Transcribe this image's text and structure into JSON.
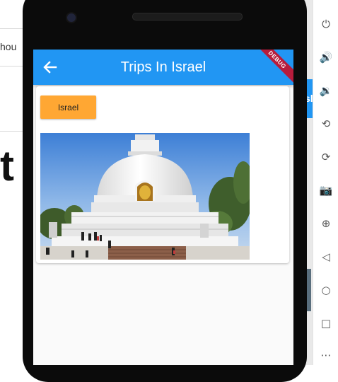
{
  "background": {
    "left_snippet": "hou",
    "left_big_letter": "t",
    "right_tab_text": "sl"
  },
  "side_toolbar": [
    {
      "name": "power-icon",
      "glyph": "⏻"
    },
    {
      "name": "volume-up-icon",
      "glyph": "🔊"
    },
    {
      "name": "volume-down-icon",
      "glyph": "🔉"
    },
    {
      "name": "rotate-left-icon",
      "glyph": "⟲"
    },
    {
      "name": "rotate-right-icon",
      "glyph": "⟳"
    },
    {
      "name": "camera-icon",
      "glyph": "📷"
    },
    {
      "name": "zoom-icon",
      "glyph": "⊕"
    },
    {
      "name": "back-icon",
      "glyph": "◁"
    },
    {
      "name": "home-icon",
      "glyph": "○"
    },
    {
      "name": "overview-icon",
      "glyph": "□"
    },
    {
      "name": "more-icon",
      "glyph": "⋯"
    }
  ],
  "app": {
    "title": "Trips In Israel",
    "debug_banner": "DEBUG",
    "card": {
      "chip_label": "Israel",
      "image_alt": "White stupa with golden Buddha statue under a blue sky"
    }
  },
  "colors": {
    "appbar": "#2196f3",
    "chip": "#ffa733",
    "debug": "#b71c3c",
    "screen_bg": "#fafafa"
  }
}
